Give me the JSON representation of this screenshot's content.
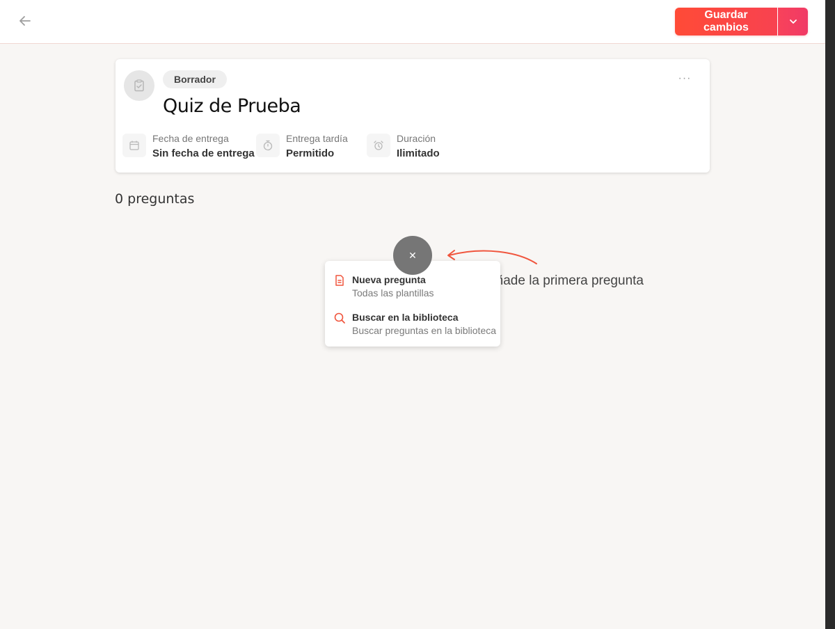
{
  "topbar": {
    "back_icon": "arrow-left-icon",
    "save_label": "Guardar cambios",
    "dropdown_icon": "chevron-down-icon"
  },
  "quiz": {
    "status": "Borrador",
    "title": "Quiz de Prueba",
    "more_icon": "ellipsis-icon",
    "meta": [
      {
        "label": "Fecha de entrega",
        "value": "Sin fecha de entrega",
        "icon": "calendar-icon"
      },
      {
        "label": "Entrega tardía",
        "value": "Permitido",
        "icon": "stopwatch-icon"
      },
      {
        "label": "Duración",
        "value": "Ilimitado",
        "icon": "alarm-clock-icon"
      }
    ]
  },
  "questions": {
    "count_label": "0 preguntas",
    "hint": "Añade la primera pregunta",
    "fab_icon": "close-icon"
  },
  "menu": {
    "items": [
      {
        "title": "Nueva pregunta",
        "subtitle": "Todas las plantillas",
        "icon": "document-icon"
      },
      {
        "title": "Buscar en la biblioteca",
        "subtitle": "Buscar preguntas en la biblioteca",
        "icon": "search-icon"
      }
    ]
  },
  "colors": {
    "accent": "#ff4b37",
    "accent_end": "#f03a66",
    "fab": "#767676"
  }
}
